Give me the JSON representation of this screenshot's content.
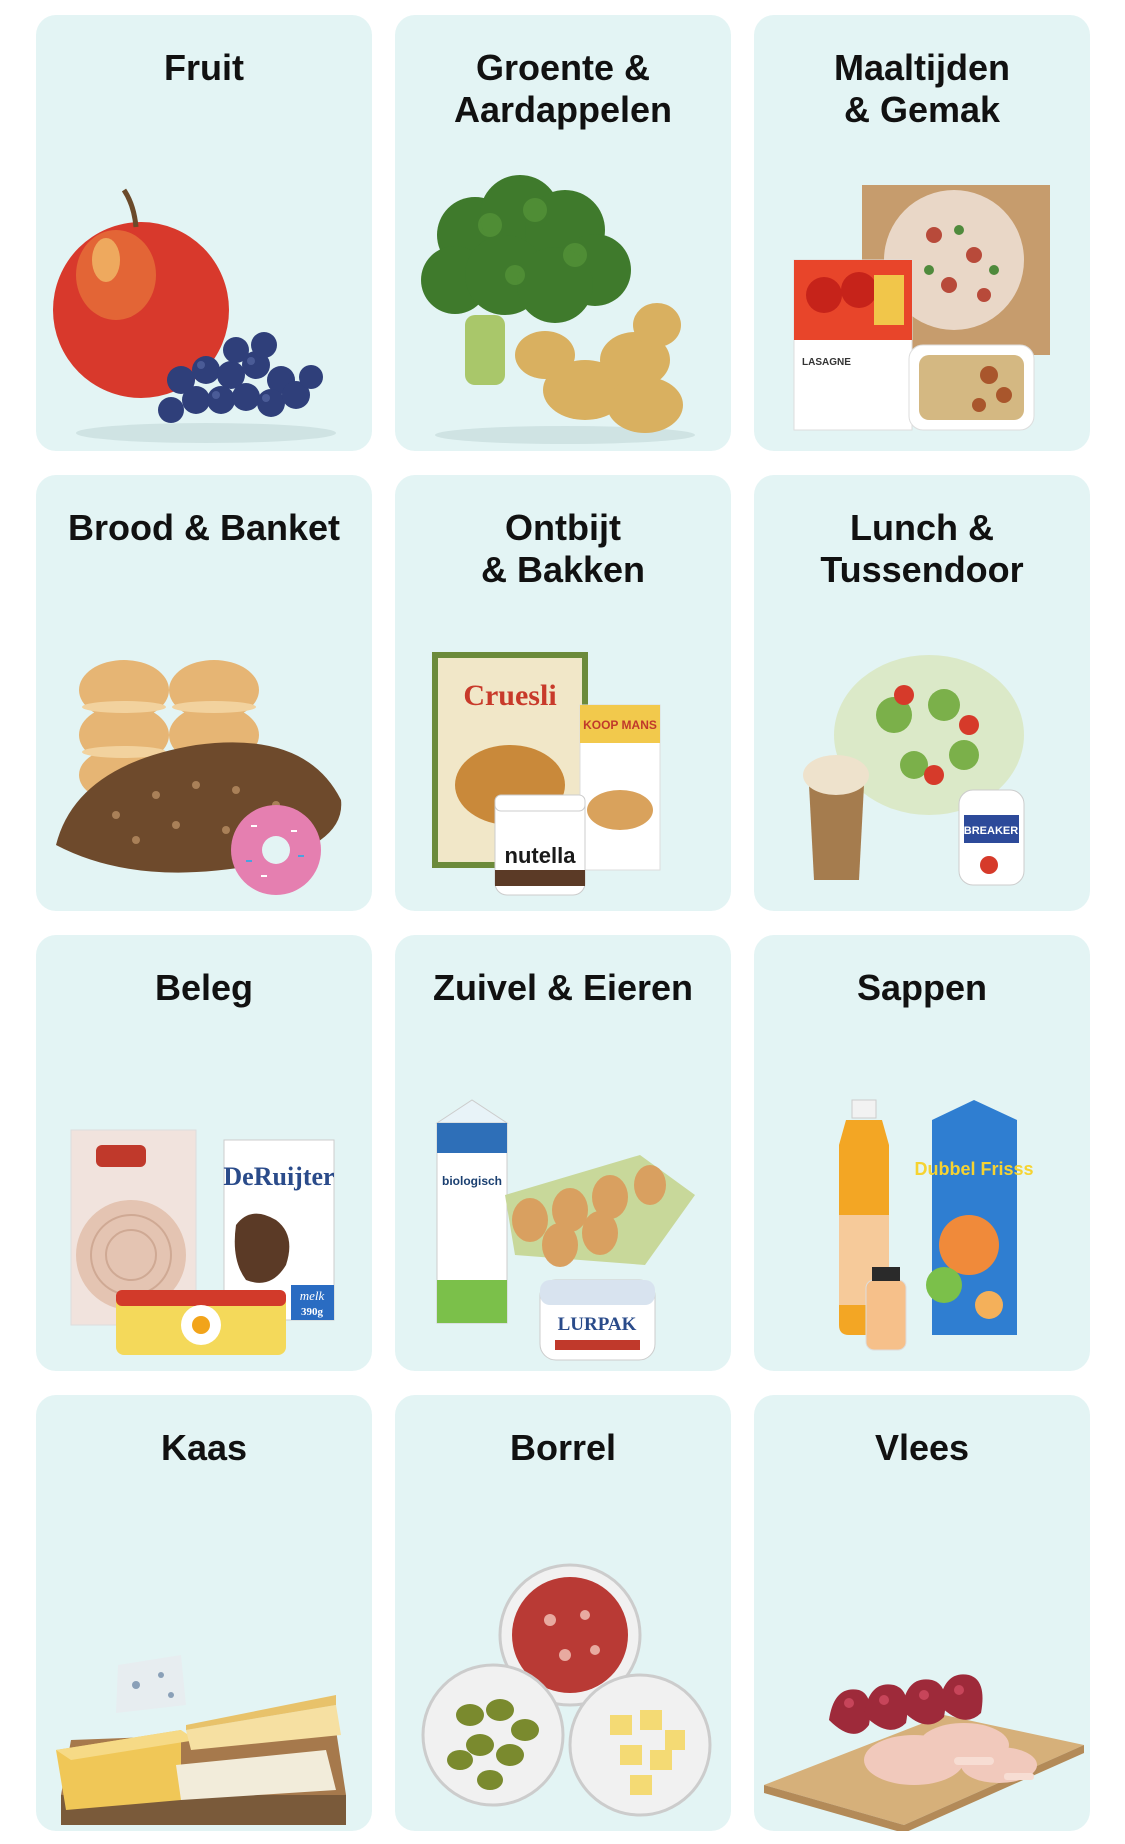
{
  "categories": [
    {
      "id": "fruit",
      "label": "Fruit",
      "icon": "fruit-image"
    },
    {
      "id": "groente",
      "label": "Groente &\nAardappelen",
      "icon": "vegetables-image"
    },
    {
      "id": "maaltijden",
      "label": "Maaltijden\n& Gemak",
      "icon": "meals-image"
    },
    {
      "id": "brood",
      "label": "Brood & Banket",
      "icon": "bread-image"
    },
    {
      "id": "ontbijt",
      "label": "Ontbijt\n& Bakken",
      "icon": "breakfast-image"
    },
    {
      "id": "lunch",
      "label": "Lunch &\nTussendoor",
      "icon": "lunch-image"
    },
    {
      "id": "beleg",
      "label": "Beleg",
      "icon": "spreads-image"
    },
    {
      "id": "zuivel",
      "label": "Zuivel & Eieren",
      "icon": "dairy-image"
    },
    {
      "id": "sappen",
      "label": "Sappen",
      "icon": "juice-image"
    },
    {
      "id": "kaas",
      "label": "Kaas",
      "icon": "cheese-image"
    },
    {
      "id": "borrel",
      "label": "Borrel",
      "icon": "snacks-image"
    },
    {
      "id": "vlees",
      "label": "Vlees",
      "icon": "meat-image"
    }
  ],
  "product_text": {
    "cruesli": "Cruesli",
    "nutella": "nutella",
    "koopmans": "KOOP MANS",
    "breaker": "BREAKER",
    "deruijter": "DeRuijter",
    "melk": "melk",
    "gram": "390g",
    "biologisch": "biologisch",
    "lurpak": "LURPAK",
    "dubbelfrisss": "Dubbel Frisss",
    "lasagne": "LASAGNE"
  },
  "colors": {
    "card_bg": "#e3f4f4",
    "title": "#111111",
    "page_bg": "#ffffff"
  }
}
